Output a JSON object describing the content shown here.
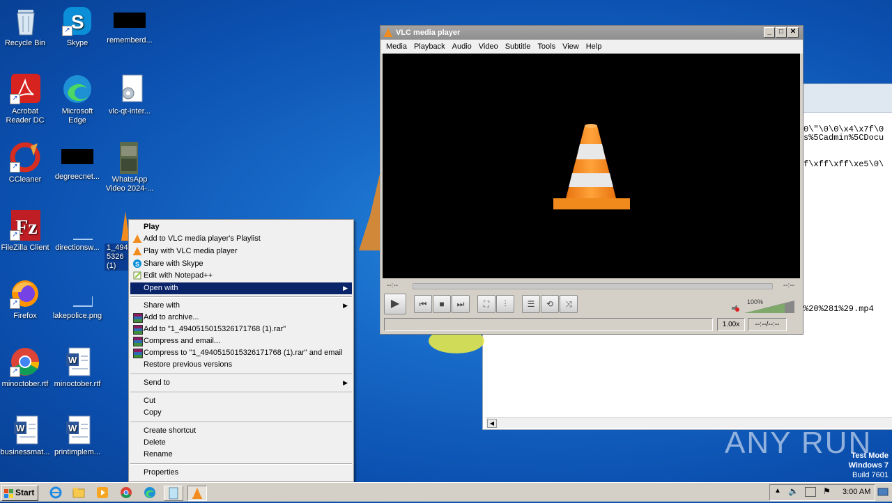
{
  "desktop": {
    "icons": [
      {
        "label": "Recycle Bin"
      },
      {
        "label": "Skype"
      },
      {
        "label": "rememberd..."
      },
      {
        "label": "Acrobat Reader DC"
      },
      {
        "label": "Microsoft Edge"
      },
      {
        "label": "vlc-qt-inter..."
      },
      {
        "label": "CCleaner"
      },
      {
        "label": "degreecnet..."
      },
      {
        "label": "WhatsApp Video 2024-..."
      },
      {
        "label": "FileZilla Client"
      },
      {
        "label": "directionsw..."
      },
      {
        "label": "1_494 5326 (1)"
      },
      {
        "label": "Firefox"
      },
      {
        "label": "lakepolice.png"
      },
      {
        "label": "Google Chrome"
      },
      {
        "label": "minoctober.rtf"
      },
      {
        "label": "businessmat..."
      },
      {
        "label": "printimplem..."
      }
    ],
    "watermark": "ANY RUN",
    "os_info": {
      "line1": "Test Mode",
      "line2": "Windows 7",
      "line3": "Build 7601"
    }
  },
  "background_window": {
    "lines": [
      "0\\\"\\0\\0\\x4\\x7f\\0",
      "s%5Cadmin%5CDocu",
      "f\\xff\\xff\\xe5\\0\\",
      "%20%281%29.mp4"
    ]
  },
  "vlc": {
    "title": "VLC media player",
    "menu": [
      "Media",
      "Playback",
      "Audio",
      "Video",
      "Subtitle",
      "Tools",
      "View",
      "Help"
    ],
    "time_elapsed": "--:--",
    "time_total": "--:--",
    "volume": "100%",
    "speed": "1.00x",
    "time_display": "--:--/--:--"
  },
  "context_menu": {
    "items": [
      {
        "label": "Play",
        "bold": true
      },
      {
        "label": "Add to VLC media player's Playlist"
      },
      {
        "label": "Play with VLC media player"
      },
      {
        "label": "Share with Skype"
      },
      {
        "label": "Edit with Notepad++"
      },
      {
        "label": "Open with",
        "submenu": true,
        "highlighted": true
      },
      {
        "label": "Share with",
        "submenu": true
      },
      {
        "label": "Add to archive..."
      },
      {
        "label": "Add to \"1_4940515015326171768 (1).rar\""
      },
      {
        "label": "Compress and email..."
      },
      {
        "label": "Compress to \"1_4940515015326171768 (1).rar\" and email"
      },
      {
        "label": "Restore previous versions"
      },
      {
        "label": "Send to",
        "submenu": true
      },
      {
        "label": "Cut"
      },
      {
        "label": "Copy"
      },
      {
        "label": "Create shortcut"
      },
      {
        "label": "Delete"
      },
      {
        "label": "Rename"
      },
      {
        "label": "Properties"
      }
    ]
  },
  "taskbar": {
    "start_label": "Start",
    "clock": "3:00 AM"
  },
  "colors": {
    "highlight": "#0a246a",
    "vlc_orange": "#f28c1e",
    "desktop_blue": "#1769c8"
  }
}
